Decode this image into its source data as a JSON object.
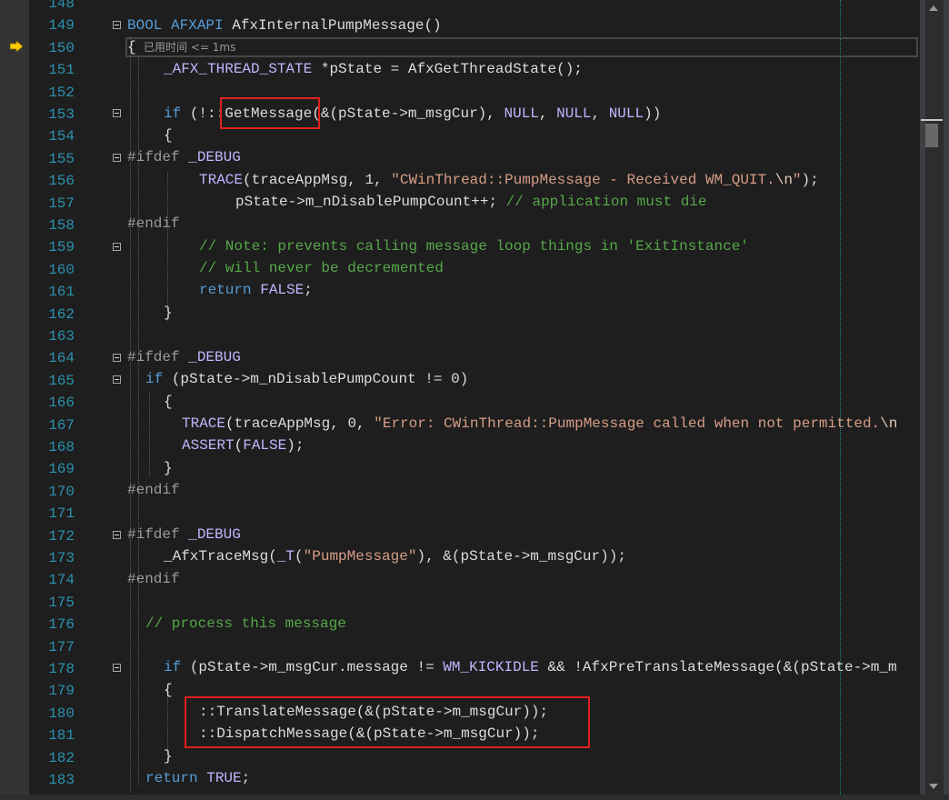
{
  "editor": {
    "current_line": "150",
    "perf_tip": "已用时间 <= 1ms",
    "line_numbers": [
      "148",
      "149",
      "150",
      "151",
      "152",
      "153",
      "154",
      "155",
      "156",
      "157",
      "158",
      "159",
      "160",
      "161",
      "162",
      "163",
      "164",
      "165",
      "166",
      "167",
      "168",
      "169",
      "170",
      "171",
      "172",
      "173",
      "174",
      "175",
      "176",
      "177",
      "178",
      "179",
      "180",
      "181",
      "182",
      "183"
    ],
    "lines": {
      "l149": {
        "a": "BOOL AFXAPI ",
        "b": "AfxInternalPumpMessage",
        "c": "()"
      },
      "l150": {
        "a": "{"
      },
      "l151": {
        "a": "_AFX_THREAD_STATE ",
        "b": "*",
        "c": "pState",
        "d": " = ",
        "e": "AfxGetThreadState",
        "f": "();"
      },
      "l153": {
        "a": "if ",
        "b": "(!::",
        "c": "GetMessage",
        "d": "(&(",
        "e": "pState",
        "f": "->",
        "g": "m_msgCur",
        "h": "), ",
        "i": "NULL",
        "j": ", ",
        "k": "NULL",
        "l": ", ",
        "m": "NULL",
        "n": "))"
      },
      "l154": {
        "a": "{"
      },
      "l155": {
        "a": "#ifdef ",
        "b": "_DEBUG"
      },
      "l156": {
        "a": "TRACE",
        "b": "(traceAppMsg, 1, ",
        "c": "\"CWinThread::PumpMessage - Received WM_QUIT.",
        "d": "\\n",
        "e": "\"",
        "f": ");"
      },
      "l157": {
        "a": "pState",
        "b": "->",
        "c": "m_nDisablePumpCount",
        "d": "++; ",
        "e": "// application must die"
      },
      "l158": {
        "a": "#endif"
      },
      "l159": {
        "a": "// Note: prevents calling message loop things in 'ExitInstance'"
      },
      "l160": {
        "a": "// will never be decremented"
      },
      "l161": {
        "a": "return ",
        "b": "FALSE",
        "c": ";"
      },
      "l162": {
        "a": "}"
      },
      "l164": {
        "a": "#ifdef ",
        "b": "_DEBUG"
      },
      "l165": {
        "a": "if ",
        "b": "(",
        "c": "pState",
        "d": "->",
        "e": "m_nDisablePumpCount",
        "f": " != 0)"
      },
      "l166": {
        "a": "{"
      },
      "l167": {
        "a": "TRACE",
        "b": "(traceAppMsg, 0, ",
        "c": "\"Error: CWinThread::PumpMessage called when not permitted.",
        "d": "\\n"
      },
      "l168": {
        "a": "ASSERT",
        "b": "(",
        "c": "FALSE",
        "d": ");"
      },
      "l169": {
        "a": "}"
      },
      "l170": {
        "a": "#endif"
      },
      "l172": {
        "a": "#ifdef ",
        "b": "_DEBUG"
      },
      "l173": {
        "a": "_AfxTraceMsg",
        "b": "(",
        "c": "_T",
        "d": "(",
        "e": "\"PumpMessage\"",
        "f": "), &(",
        "g": "pState",
        "h": "->",
        "i": "m_msgCur",
        "j": "));"
      },
      "l174": {
        "a": "#endif"
      },
      "l176": {
        "a": "// process this message"
      },
      "l178": {
        "a": "if ",
        "b": "(",
        "c": "pState",
        "d": "->",
        "e": "m_msgCur",
        "f": ".",
        "g": "message",
        "h": " != ",
        "i": "WM_KICKIDLE",
        "j": " && !",
        "k": "AfxPreTranslateMessage",
        "l": "(&(",
        "m": "pState",
        "n": "->",
        "o": "m_m"
      },
      "l179": {
        "a": "{"
      },
      "l180": {
        "a": "::",
        "b": "TranslateMessage",
        "c": "(&(",
        "d": "pState",
        "e": "->",
        "f": "m_msgCur",
        "g": "));"
      },
      "l181": {
        "a": "::",
        "b": "DispatchMessage",
        "c": "(&(",
        "d": "pState",
        "e": "->",
        "f": "m_msgCur",
        "g": "));"
      },
      "l182": {
        "a": "}"
      },
      "l183": {
        "a": "return ",
        "b": "TRUE",
        "c": ";"
      }
    }
  },
  "colors": {
    "background": "#1e1e1e",
    "line_number": "#2b91af",
    "keyword": "#569cd6",
    "macro": "#beb7ff",
    "comment": "#57a64a",
    "string": "#d69d85",
    "highlight_box": "#e0201e"
  },
  "icons": {
    "execution_pointer": "yellow-arrow-icon",
    "fold_toggle": "collapse-minus-icon"
  }
}
